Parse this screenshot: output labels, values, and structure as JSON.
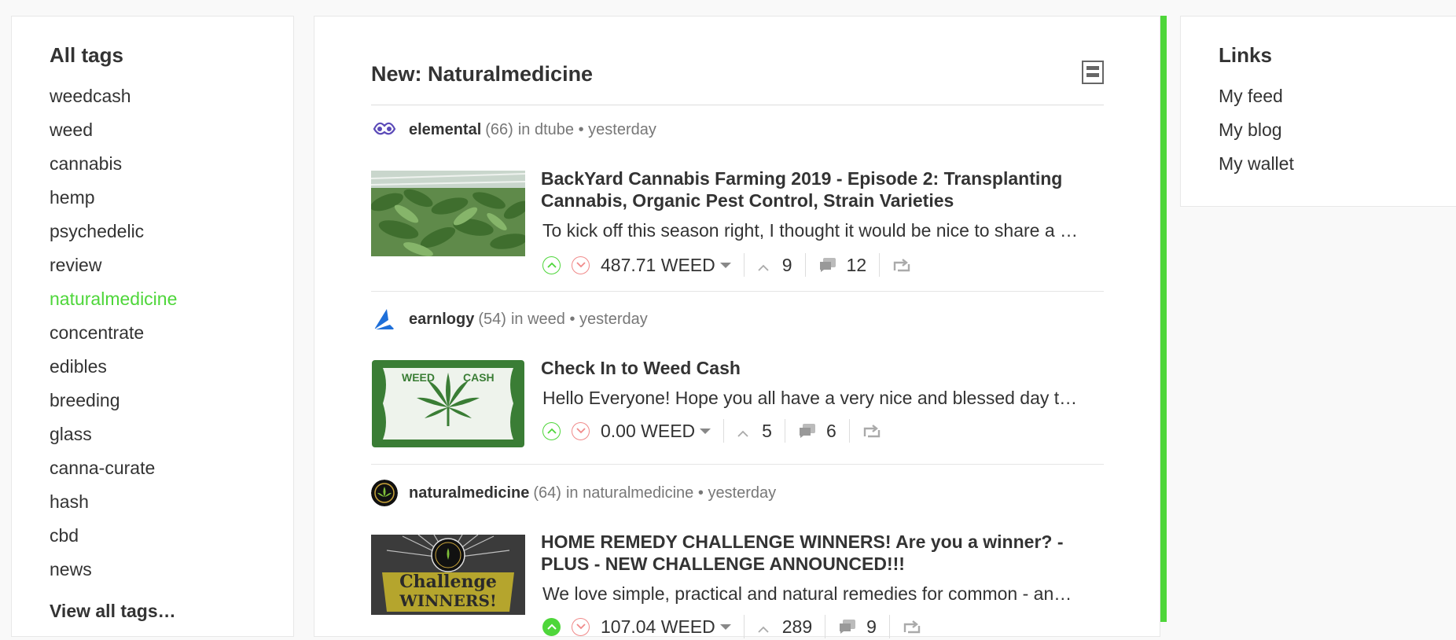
{
  "left_sidebar": {
    "title": "All tags",
    "tags": [
      "weedcash",
      "weed",
      "cannabis",
      "hemp",
      "psychedelic",
      "review",
      "naturalmedicine",
      "concentrate",
      "edibles",
      "breeding",
      "glass",
      "canna-curate",
      "hash",
      "cbd",
      "news"
    ],
    "active_tag": "naturalmedicine",
    "view_all": "View all tags…"
  },
  "feed": {
    "title": "New: Naturalmedicine",
    "posts": [
      {
        "author": "elemental",
        "reputation": "(66)",
        "in_label": "in",
        "category": "dtube",
        "time": "yesterday",
        "title": "BackYard Cannabis Farming 2019 - Episode 2: Transplanting Cannabis, Organic Pest Control, Strain Varieties",
        "excerpt": "To kick off this season right, I thought it would be nice to share a …",
        "payout": "487.71 WEED",
        "votes": "9",
        "comments": "12"
      },
      {
        "author": "earnlogy",
        "reputation": "(54)",
        "in_label": "in",
        "category": "weed",
        "time": "yesterday",
        "title": "Check In to Weed Cash",
        "excerpt": "Hello Everyone! Hope you all have a very nice and blessed day t…",
        "payout": "0.00 WEED",
        "votes": "5",
        "comments": "6",
        "thumb_text_left": "WEED",
        "thumb_text_right": "CASH"
      },
      {
        "author": "naturalmedicine",
        "reputation": "(64)",
        "in_label": "in",
        "category": "naturalmedicine",
        "time": "yesterday",
        "title": "HOME REMEDY CHALLENGE WINNERS! Are you a winner? - PLUS - NEW CHALLENGE ANNOUNCED!!!",
        "excerpt": "We love simple, practical and natural remedies for common - an…",
        "payout": "107.04 WEED",
        "votes": "289",
        "comments": "9",
        "thumb_text_top": "Challenge",
        "thumb_text_bottom": "WINNERS!"
      }
    ]
  },
  "right_sidebar": {
    "title": "Links",
    "links": [
      "My feed",
      "My blog",
      "My wallet"
    ]
  },
  "colors": {
    "accent": "#4ed63a",
    "downvote": "#f08a8a",
    "text": "#333333",
    "muted": "#777777"
  },
  "icons": [
    "upvote-icon",
    "downvote-icon",
    "caret-down-icon",
    "chevron-up-icon",
    "comments-icon",
    "reblog-icon",
    "layout-toggle-icon"
  ]
}
